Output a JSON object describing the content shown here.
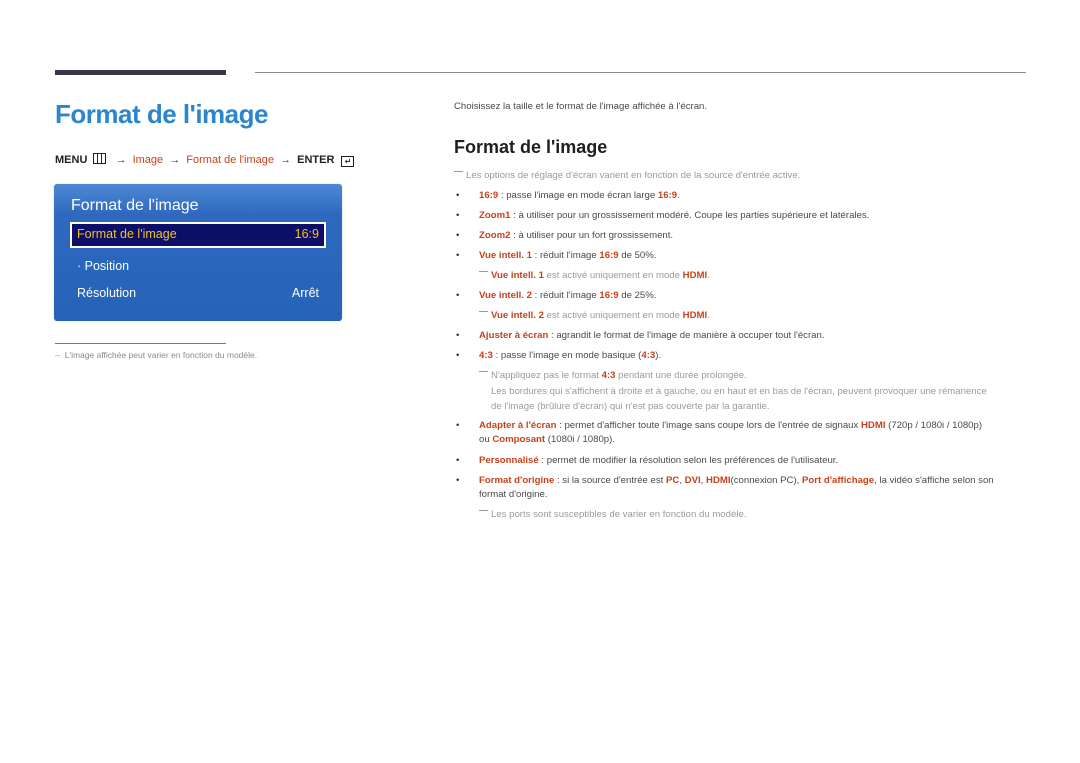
{
  "page": {
    "title": "Format de l'image",
    "menu_path": {
      "menu": "MENU",
      "arrow": "→",
      "image": "Image",
      "format": "Format de l'image",
      "enter": "ENTER"
    },
    "osd": {
      "title": "Format de l'image",
      "rows": [
        {
          "label": "Format de l'image",
          "value": "16:9",
          "selected": true
        },
        {
          "label": "· Position",
          "value": ""
        },
        {
          "label": "Résolution",
          "value": "Arrêt"
        }
      ]
    },
    "footnote": {
      "dash": "–",
      "text": "L'image affichée peut varier en fonction du modèle."
    }
  },
  "content": {
    "intro": "Choisissez la taille et le format de l'image affichée à l'écran.",
    "section_title": "Format de l'image",
    "note_top": "Les options de réglage d'écran varient en fonction de la source d'entrée active.",
    "bullet_glyph": "•",
    "items": {
      "i169": {
        "term": "16:9",
        "sep": " : passe l'image en mode écran large ",
        "term2": "16:9",
        "end": "."
      },
      "zoom1": {
        "term": "Zoom1",
        "text": " : à utiliser pour un grossissement modéré. Coupe les parties supérieure et latérales."
      },
      "zoom2": {
        "term": "Zoom2",
        "text": " : à utiliser pour un fort grossissement."
      },
      "vue1": {
        "term": "Vue intell. 1",
        "sep": " : réduit l'image ",
        "term2": "16:9",
        "end": " de 50%."
      },
      "vue1_note": {
        "term": "Vue intell. 1",
        "text": " est activé uniquement en mode ",
        "term2": "HDMI",
        "end": "."
      },
      "vue2": {
        "term": "Vue intell. 2",
        "sep": " : réduit l'image ",
        "term2": "16:9",
        "end": " de 25%."
      },
      "vue2_note": {
        "term": "Vue intell. 2",
        "text": "  est activé uniquement en mode ",
        "term2": "HDMI",
        "end": "."
      },
      "ajuster": {
        "term": "Ajuster à écran",
        "text": " : agrandit le format de l'image de manière à occuper tout l'écran."
      },
      "i43": {
        "term": "4:3",
        "sep": " : passe l'image en mode basique (",
        "term2": "4:3",
        "end": ")."
      },
      "i43_note": {
        "pre": "N'appliquez pas le format ",
        "term": "4:3",
        "post": " pendant une durée prolongée."
      },
      "i43_note_line2": "Les bordures qui s'affichent à droite et à gauche, ou en haut et en bas de l'écran, peuvent provoquer une rémanence",
      "i43_note_line3": "de l'image (brûlure d'écran) qui n'est pas couverte par la garantie.",
      "adapter": {
        "term": "Adapter à l'écran",
        "text": " : permet d'afficher toute l'image sans coupe lors de l'entrée de signaux ",
        "term2": "HDMI",
        "end": " (720p / 1080i / 1080p)"
      },
      "adapter_line2": {
        "pre": "ou ",
        "term": "Composant",
        "post": " (1080i / 1080p)."
      },
      "perso": {
        "term": "Personnalisé",
        "text": " : permet de modifier la résolution selon les préférences de l'utilisateur."
      },
      "origine": {
        "term": "Format d'origine",
        "t1": " : si la source d'entrée est ",
        "pc": "PC",
        "c1": ", ",
        "dvi": "DVI",
        "c2": ", ",
        "hdmi": "HDMI",
        "t2": "(connexion PC), ",
        "port": "Port d'affichage",
        "t3": ", la vidéo s'affiche selon son"
      },
      "origine_line2": "format d'origine.",
      "ports_note": "Les ports sont susceptibles de varier en fonction du modèle."
    }
  },
  "colors": {
    "title_blue": "#2b86cc",
    "highlight": "#c8411b",
    "osd_bg": "#2563b8",
    "osd_selected_bg": "#0d0f66",
    "osd_selected_text": "#f3c21c"
  }
}
